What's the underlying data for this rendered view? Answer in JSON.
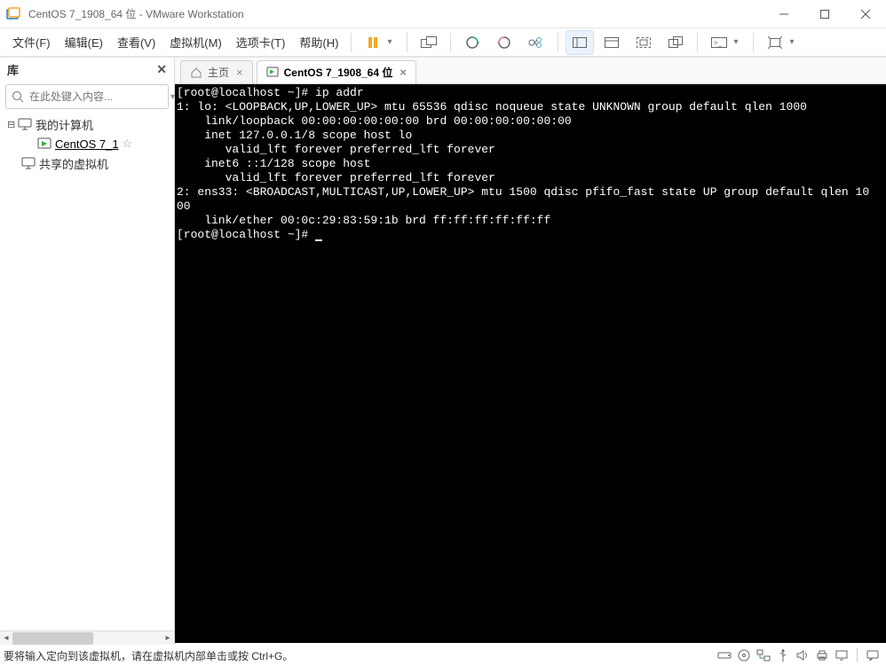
{
  "title": "CentOS 7_1908_64 位 - VMware Workstation",
  "menu": {
    "file": "文件(F)",
    "edit": "编辑(E)",
    "view": "查看(V)",
    "vm": "虚拟机(M)",
    "tabs": "选项卡(T)",
    "help": "帮助(H)"
  },
  "sidebar": {
    "header": "库",
    "search_placeholder": "在此处键入内容...",
    "root": "我的计算机",
    "child": "CentOS 7_1",
    "shared": "共享的虚拟机"
  },
  "tabs": {
    "home": "主页",
    "active": "CentOS 7_1908_64 位"
  },
  "terminal": {
    "lines": [
      "[root@localhost ~]# ip addr",
      "1: lo: <LOOPBACK,UP,LOWER_UP> mtu 65536 qdisc noqueue state UNKNOWN group default qlen 1000",
      "    link/loopback 00:00:00:00:00:00 brd 00:00:00:00:00:00",
      "    inet 127.0.0.1/8 scope host lo",
      "       valid_lft forever preferred_lft forever",
      "    inet6 ::1/128 scope host",
      "       valid_lft forever preferred_lft forever",
      "2: ens33: <BROADCAST,MULTICAST,UP,LOWER_UP> mtu 1500 qdisc pfifo_fast state UP group default qlen 10",
      "00",
      "    link/ether 00:0c:29:83:59:1b brd ff:ff:ff:ff:ff:ff",
      "[root@localhost ~]# "
    ]
  },
  "statusbar": {
    "text": "要将输入定向到该虚拟机，请在虚拟机内部单击或按 Ctrl+G。"
  }
}
